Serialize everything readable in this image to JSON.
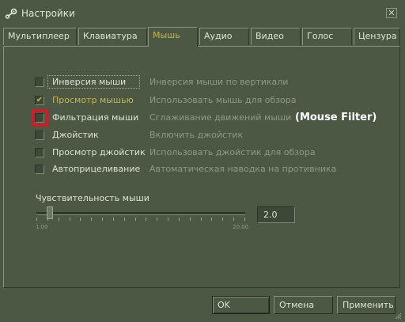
{
  "window": {
    "title": "Настройки",
    "close_glyph": "✕"
  },
  "tabs": [
    {
      "label": "Мультиплеер",
      "active": false
    },
    {
      "label": "Клавиатура",
      "active": false
    },
    {
      "label": "Мышь",
      "active": true
    },
    {
      "label": "Аудио",
      "active": false
    },
    {
      "label": "Видео",
      "active": false
    },
    {
      "label": "Голос",
      "active": false
    },
    {
      "label": "Цензура",
      "active": false
    }
  ],
  "options": [
    {
      "label": "Инверсия мыши",
      "description": "Инверсия мыши по вертикали",
      "checked": false
    },
    {
      "label": "Просмотр мышью",
      "description": "Использовать мышь для обзора",
      "checked": true
    },
    {
      "label": "Фильтрация мыши",
      "description": "Сглаживание движений мыши",
      "checked": false
    },
    {
      "label": "Джойстик",
      "description": "Включить джойстик",
      "checked": false
    },
    {
      "label": "Просмотр джойстик",
      "description": "Использовать джойстик для обзора",
      "checked": false
    },
    {
      "label": "Автоприцеливание",
      "description": "Автоматическая наводка на противника",
      "checked": false
    }
  ],
  "check_glyph": "✔",
  "annotation": "(Mouse Filter)",
  "sensitivity": {
    "label": "Чувствительность мыши",
    "min_label": "1.00",
    "max_label": "20.00",
    "value": "2.0",
    "min": 1,
    "max": 20,
    "current": 2
  },
  "buttons": {
    "ok": "OK",
    "cancel": "Отмена",
    "apply": "Применить"
  },
  "colors": {
    "background": "#4c5844",
    "accent": "#c4b550",
    "highlight": "#c8202a"
  }
}
